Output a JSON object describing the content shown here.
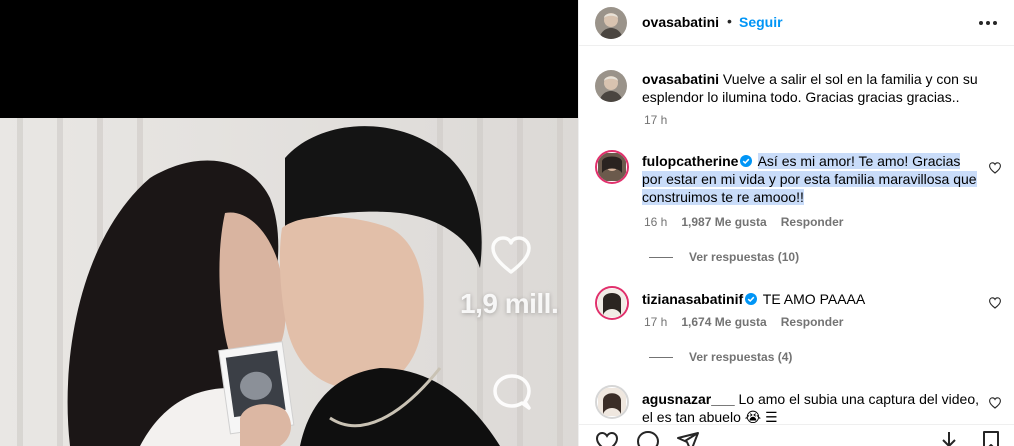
{
  "overlay": {
    "like_count": "1,9 mill."
  },
  "header": {
    "username": "ovasabatini",
    "separator": "•",
    "follow_label": "Seguir"
  },
  "caption": {
    "username": "ovasabatini",
    "text": "Vuelve a salir el sol en la familia y con su esplendor lo ilumina todo. Gracias gracias gracias..",
    "time": "17 h"
  },
  "comments": [
    {
      "username": "fulopcatherine",
      "verified": true,
      "text": "Así es mi amor! Te amo! Gracias por estar en mi vida y por esta familia maravillosa que construimos te re amooo!!",
      "time": "16 h",
      "likes": "1,987 Me gusta",
      "reply_label": "Responder",
      "view_replies": "Ver respuestas (10)"
    },
    {
      "username": "tizianasabatinif",
      "verified": true,
      "text": "TE AMO PAAAA",
      "time": "17 h",
      "likes": "1,674 Me gusta",
      "reply_label": "Responder",
      "view_replies": "Ver respuestas (4)"
    },
    {
      "username": "agusnazar___",
      "verified": false,
      "text": "Lo amo el subia una captura del video, el es tan abuelo 😭 ☰",
      "time": "",
      "likes": "",
      "reply_label": ""
    }
  ],
  "colors": {
    "accent": "#0095f6",
    "highlight": "#c9dcf9",
    "secondary_text": "#737373",
    "verified": "#0095f6"
  },
  "icons": [
    "heart-icon",
    "comment-icon",
    "share-icon",
    "save-icon",
    "more-icon",
    "verified-icon",
    "download-icon"
  ]
}
